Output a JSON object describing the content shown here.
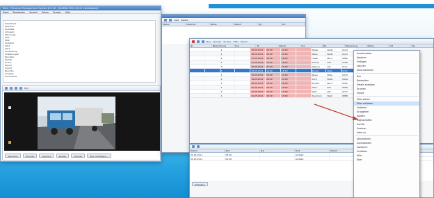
{
  "app": {
    "title": "Beta - Personen Management System 8.0.18 - [ALUMNI 2011-01-01 Installations]",
    "menu": [
      "Datei",
      "Bearbeiten",
      "Ansicht",
      "Extras",
      "Fenster",
      "Hilfe"
    ]
  },
  "tree": {
    "items": [
      "Datenbank",
      "  Personen",
      "    Kontakte",
      "    Adressen",
      "  Fahrzeuge",
      "    LKW",
      "    PKW",
      "  Protokoll",
      "    2011",
      "    2012",
      "  Auswertung",
      "  Einstellungen",
      "    Benutzer",
      "    Rechte",
      "  Archiv",
      "  Export",
      "  Import",
      "  Berichte",
      "  Vorlagen",
      "  Dokumente"
    ]
  },
  "viewer": {
    "toolbar_label": "Bild",
    "buttons": [
      "Speichern",
      "Drucken",
      "Kopieren",
      "Details",
      "Löschen",
      "Bild hinzufügen..."
    ]
  },
  "mid_window": {
    "tabs": [
      "Liste",
      "Details"
    ],
    "headers": [
      "Status",
      "Nummer",
      "Name",
      "Datum",
      "Typ",
      "Ort"
    ]
  },
  "main_window": {
    "toolbar": [
      "Neu",
      "Löschen",
      "Suchen",
      "Filter",
      "Export"
    ],
    "headers": [
      "Nr",
      "Bezeichnung",
      "Anz",
      "St",
      "Datum",
      "Von",
      "Bis",
      "Bemerkung",
      "Name",
      "Ort",
      "Tel"
    ],
    "rows": [
      [
        "",
        "",
        "1",
        "",
        "16.05.2011",
        "06:00",
        "14:00",
        "",
        "Müller",
        "Stadt",
        "0123"
      ],
      [
        "",
        "",
        "1",
        "",
        "16.05.2011",
        "06:00",
        "14:00",
        "",
        "Meier",
        "Stadt",
        "0123"
      ],
      [
        "",
        "",
        "2",
        "",
        "17.05.2011",
        "08:00",
        "16:00",
        "",
        "Huber",
        "Nord",
        "0456"
      ],
      [
        "",
        "",
        "1",
        "",
        "17.05.2011",
        "08:00",
        "16:00",
        "",
        "Schulz",
        "Süd",
        "0789"
      ],
      [
        "",
        "",
        "3",
        "",
        "18.05.2011",
        "06:00",
        "14:00",
        "",
        "Wagner",
        "Ost",
        "0111"
      ],
      [
        "",
        "",
        "1",
        "",
        "18.05.2011",
        "10:00",
        "18:00",
        "",
        "Becker",
        "West",
        "0222"
      ],
      [
        "",
        "",
        "1",
        "",
        "19.05.2011",
        "06:00",
        "14:00",
        "",
        "Bauer",
        "Mitte",
        "0333"
      ],
      [
        "",
        "",
        "2",
        "",
        "19.05.2011",
        "06:00",
        "14:00",
        "",
        "Koch",
        "Stadt",
        "0444"
      ],
      [
        "",
        "",
        "1",
        "",
        "20.05.2011",
        "08:00",
        "16:00",
        "",
        "Richter",
        "Nord",
        "0555"
      ],
      [
        "",
        "",
        "1",
        "",
        "20.05.2011",
        "08:00",
        "16:00",
        "",
        "Klein",
        "Süd",
        "0666"
      ],
      [
        "",
        "",
        "2",
        "",
        "21.05.2011",
        "06:00",
        "14:00",
        "",
        "Wolf",
        "Ost",
        "0777"
      ],
      [
        "",
        "",
        "1",
        "",
        "21.05.2011",
        "06:00",
        "14:00",
        "",
        "Neumann",
        "West",
        "0888"
      ]
    ],
    "selected_row": 5,
    "bottom": {
      "headers": [
        "Datum",
        "Zeit",
        "Typ",
        "Text",
        "Datum",
        "Benutzer",
        "Bemerkung"
      ],
      "rows": [
        [
          "01.05.2011",
          "08:00",
          "",
          "Kontakt",
          "",
          "",
          ""
        ],
        [
          "01.05.2011",
          "09:00",
          "",
          "Kontakt",
          "",
          "",
          ""
        ]
      ],
      "button": "Schließen"
    }
  },
  "context_menu": {
    "items": [
      "Ausschneiden",
      "Kopieren",
      "Einfügen",
      "Löschen",
      "Alles markieren",
      "Neu",
      "Bearbeiten",
      "Details anzeigen",
      "Drucken",
      "Export",
      "Filter setzen",
      "Filter aufheben",
      "Sortieren",
      "Gruppieren",
      "Spalten",
      "Eigenschaften",
      "Suchen",
      "Ersetzen",
      "Gehe zu",
      "Aktualisieren",
      "Zurücksetzen",
      "Speichern",
      "Schließen",
      "Hilfe",
      "Über"
    ],
    "highlighted": 11
  }
}
